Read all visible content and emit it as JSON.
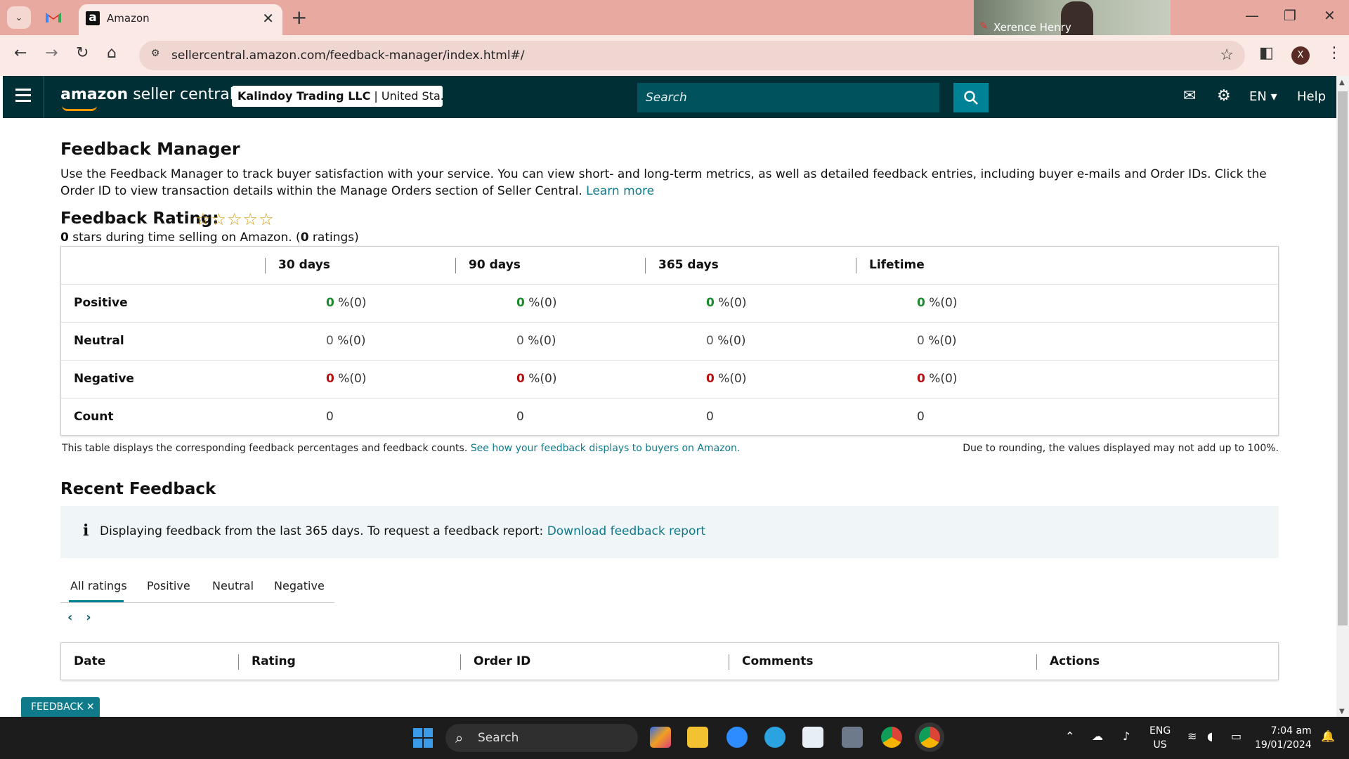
{
  "browser": {
    "tab_title": "Amazon",
    "url": "sellercentral.amazon.com/feedback-manager/index.html#/",
    "profile_initial": "X",
    "video_participant": "Xerence Henry"
  },
  "header": {
    "logo_bold": "amazon",
    "logo_rest": " seller central",
    "account_name": "Kalindoy Trading LLC",
    "account_region": " | United Sta...",
    "search_placeholder": "Search",
    "lang": "EN",
    "help": "Help"
  },
  "page": {
    "title": "Feedback Manager",
    "intro": "Use the Feedback Manager to track buyer satisfaction with your service. You can view short- and long-term metrics, as well as detailed feedback entries, including buyer e-mails and Order IDs. Click the Order ID to view transaction details within the Manage Orders section of Seller Central.",
    "learn_more": "Learn more",
    "rating_title": "Feedback Rating:",
    "stars": "☆☆☆☆☆",
    "summary_stars": "0",
    "summary_mid": " stars during time selling on Amazon. (",
    "summary_ratings": "0",
    "summary_end": " ratings)"
  },
  "feedback_table": {
    "columns": [
      "30 days",
      "90 days",
      "365 days",
      "Lifetime"
    ],
    "rows": [
      {
        "label": "Positive",
        "values": [
          "0",
          "0",
          "0",
          "0"
        ],
        "suffix": " %(0)"
      },
      {
        "label": "Neutral",
        "values": [
          "0",
          "0",
          "0",
          "0"
        ],
        "suffix": " %(0)"
      },
      {
        "label": "Negative",
        "values": [
          "0",
          "0",
          "0",
          "0"
        ],
        "suffix": " %(0)"
      },
      {
        "label": "Count",
        "values": [
          "0",
          "0",
          "0",
          "0"
        ],
        "suffix": ""
      }
    ],
    "note": "This table displays the corresponding feedback percentages and feedback counts.",
    "note_link": "See how your feedback displays to buyers on Amazon.",
    "rounding_note": "Due to rounding, the values displayed may not add up to 100%."
  },
  "recent": {
    "title": "Recent Feedback",
    "info_text": "Displaying feedback from the last 365 days. To request a feedback report:",
    "info_link": "Download feedback report",
    "tabs": [
      "All ratings",
      "Positive",
      "Neutral",
      "Negative"
    ],
    "columns": [
      "Date",
      "Rating",
      "Order ID",
      "Comments",
      "Actions"
    ]
  },
  "feedback_pill": "FEEDBACK ✕",
  "taskbar": {
    "search": "Search",
    "lang_top": "ENG",
    "lang_bottom": "US",
    "time": "7:04 am",
    "date": "19/01/2024"
  },
  "colors": {
    "header_bg": "#002f36",
    "accent": "#008296",
    "positive": "#1e8a2e",
    "negative": "#b80f0f"
  }
}
